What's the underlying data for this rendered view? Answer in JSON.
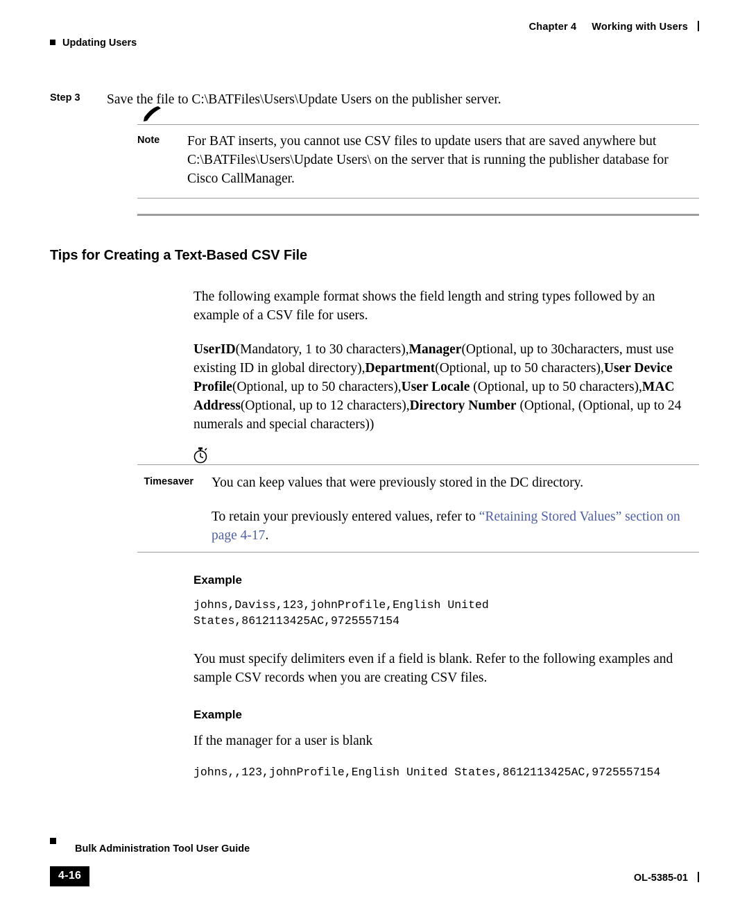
{
  "header": {
    "chapter_number": "Chapter 4",
    "chapter_title": "Working with Users",
    "running_head": "Updating Users"
  },
  "step": {
    "label": "Step 3",
    "text": "Save the file to C:\\BATFiles\\Users\\Update Users on the publisher server."
  },
  "note": {
    "icon": "pencil-note-icon",
    "label": "Note",
    "text": "For BAT inserts, you cannot use CSV files to update users that are saved anywhere but C:\\BATFiles\\Users\\Update Users\\ on the server that is running the publisher database for Cisco CallManager."
  },
  "section": {
    "title": "Tips for Creating a Text-Based CSV File",
    "intro": "The following example format shows the field length and string types followed by an example of a CSV file for users.",
    "format_spec": {
      "seg1_bold": "UserID",
      "seg1": "(Mandatory, 1 to 30 characters),",
      "seg2_bold": "Manager",
      "seg2": "(Optional, up to 30characters, must use existing ID in global directory),",
      "seg3_bold": "Department",
      "seg3": "(Optional, up to 50 characters),",
      "seg4_bold": "User Device Profile",
      "seg4": "(Optional, up to 50 characters),",
      "seg5_bold": "User Locale",
      "seg5": " (Optional, up to 50 characters),",
      "seg6_bold": "MAC Address",
      "seg6": "(Optional, up to 12 characters),",
      "seg7_bold": "Directory Number",
      "seg7": " (Optional, (Optional, up to 24 numerals and special characters))"
    }
  },
  "timesaver": {
    "icon": "stopwatch-icon",
    "label": "Timesaver",
    "line1": "You can keep values that were previously stored in the DC directory.",
    "line2_pre": "To retain your previously entered values, refer to ",
    "line2_link": "“Retaining Stored Values” section on page 4-17",
    "line2_post": ".",
    "link_color": "#4f5fa8"
  },
  "examples": [
    {
      "heading": "Example",
      "code": "johns,Daviss,123,johnProfile,English United\nStates,8612113425AC,9725557154"
    },
    {
      "heading": "Example",
      "lead": "If the manager for a user is blank",
      "code": "johns,,123,johnProfile,English United States,8612113425AC,9725557154"
    }
  ],
  "middle_para": "You must specify delimiters even if a field is blank. Refer to the following examples and sample CSV records when you are creating CSV files.",
  "footer": {
    "guide_title": "Bulk Administration Tool User Guide",
    "page_number": "4-16",
    "doc_id": "OL-5385-01"
  }
}
